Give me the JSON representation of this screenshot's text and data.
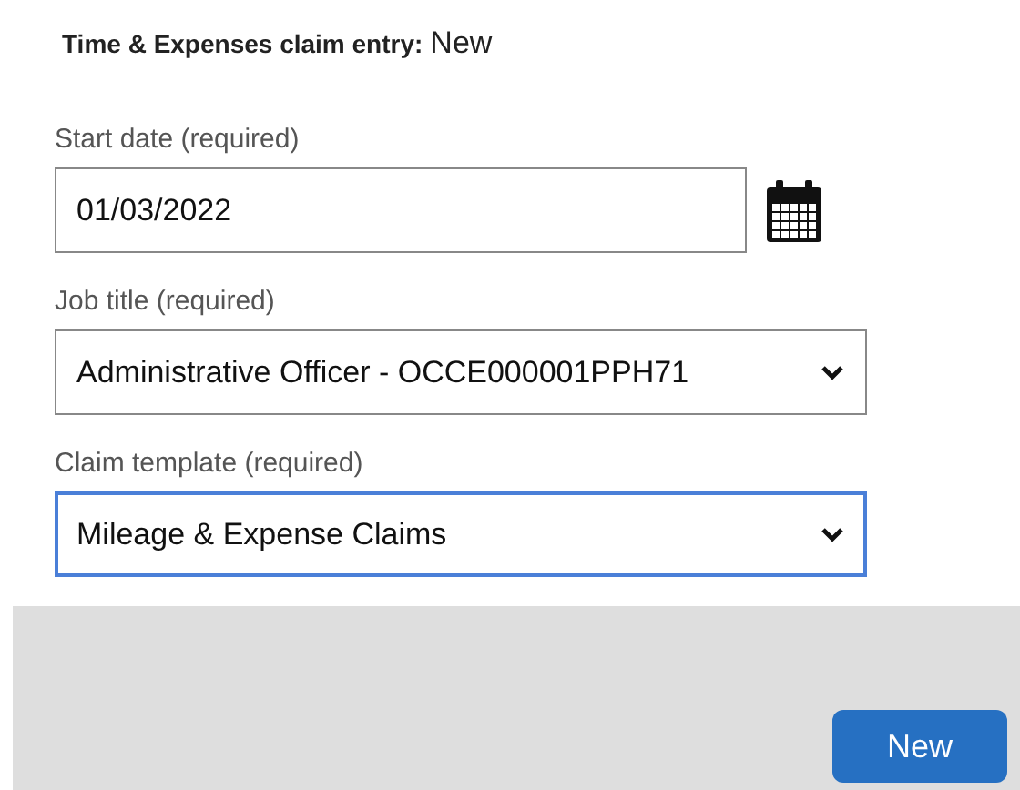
{
  "header": {
    "label": "Time & Expenses claim entry:",
    "status": "New"
  },
  "fields": [
    {
      "kind": "date",
      "label": "Start date (required)",
      "value": "01/03/2022",
      "focused": false
    },
    {
      "kind": "select",
      "label": "Job title (required)",
      "value": "Administrative Officer - OCCE000001PPH71",
      "focused": false
    },
    {
      "kind": "select",
      "label": "Claim template (required)",
      "value": "Mileage & Expense Claims",
      "focused": true
    }
  ],
  "footer": {
    "buttons": [
      "New"
    ]
  }
}
